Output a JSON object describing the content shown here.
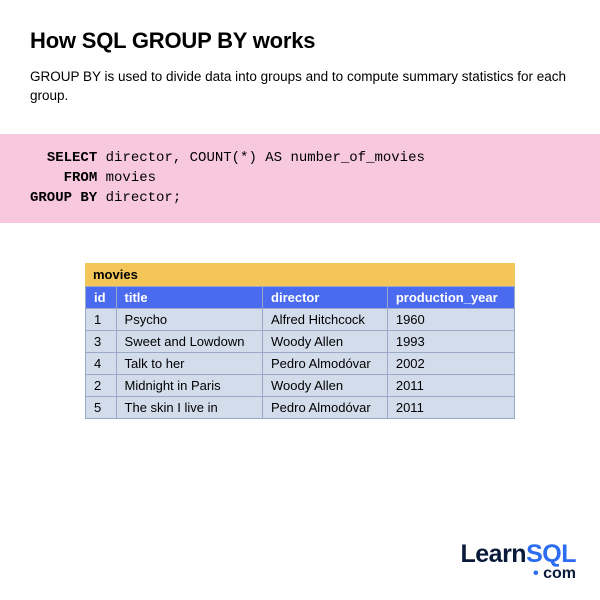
{
  "heading": "How SQL GROUP BY works",
  "description": "GROUP BY is used to divide data into groups and to compute summary statistics for each group.",
  "code": {
    "kw_select": "SELECT",
    "select_rest": " director, COUNT(*) AS number_of_movies",
    "kw_from": "FROM",
    "from_rest": " movies",
    "kw_groupby": "GROUP BY",
    "groupby_rest": " director;"
  },
  "table": {
    "name": "movies",
    "columns": [
      "id",
      "title",
      "director",
      "production_year"
    ],
    "rows": [
      {
        "c0": "1",
        "c1": "Psycho",
        "c2": "Alfred Hitchcock",
        "c3": "1960"
      },
      {
        "c0": "3",
        "c1": "Sweet and Lowdown",
        "c2": "Woody Allen",
        "c3": "1993"
      },
      {
        "c0": "4",
        "c1": "Talk to her",
        "c2": "Pedro Almodóvar",
        "c3": "2002"
      },
      {
        "c0": "2",
        "c1": "Midnight in Paris",
        "c2": "Woody Allen",
        "c3": "2011"
      },
      {
        "c0": "5",
        "c1": "The skin I live in",
        "c2": "Pedro Almodóvar",
        "c3": "2011"
      }
    ]
  },
  "logo": {
    "learn": "Learn",
    "sql": "SQL",
    "dot": "• ",
    "com": "com"
  }
}
